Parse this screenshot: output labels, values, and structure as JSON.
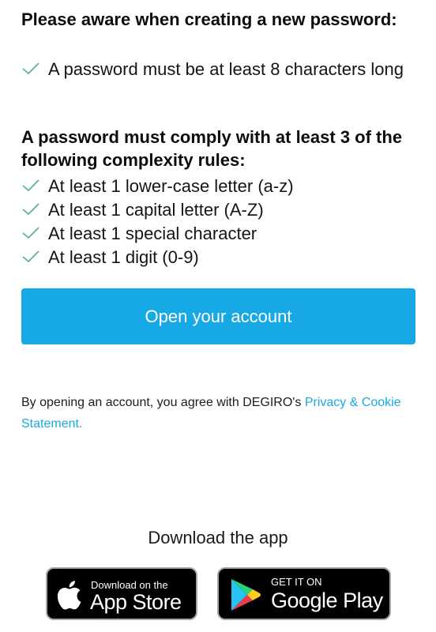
{
  "password_notice": {
    "title": "Please aware when creating a new password:",
    "length_rule": "A password must be at least 8 characters long"
  },
  "complexity": {
    "title": "A password must comply with at least 3 of the following complexity rules:",
    "rules": [
      "At least 1 lower-case letter (a-z)",
      "At least 1 capital letter (A-Z)",
      "At least 1 special character",
      "At least 1 digit (0-9)"
    ]
  },
  "cta": {
    "label": "Open your account"
  },
  "legal": {
    "text": "By opening an account, you agree with DEGIRO's ",
    "link": "Privacy & Cookie Statement."
  },
  "download": {
    "title": "Download the app",
    "app_store": {
      "small": "Download on the",
      "big": "App Store",
      "icon": "apple-icon"
    },
    "google_play": {
      "small": "GET IT ON",
      "big": "Google Play",
      "icon": "google-play-icon"
    }
  },
  "colors": {
    "accent": "#17a9e6",
    "check": "#5fb58f",
    "text": "#121212"
  }
}
